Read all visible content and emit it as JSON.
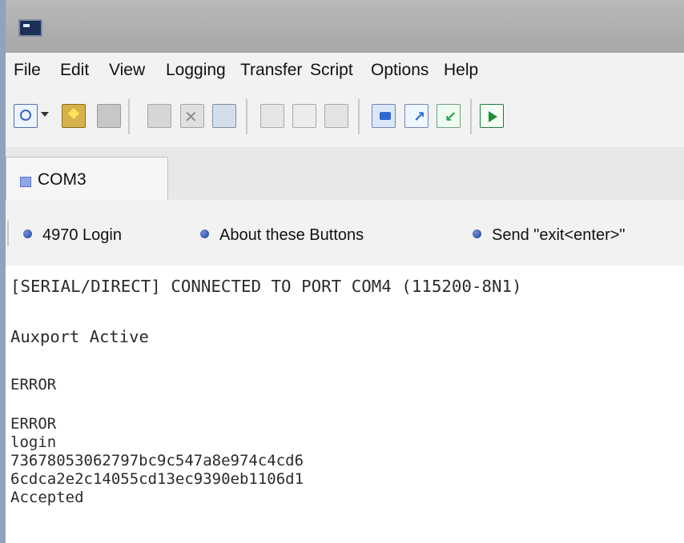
{
  "menu": [
    "File",
    "Edit",
    "View",
    "Logging",
    "Transfer",
    "Script",
    "Options",
    "Help"
  ],
  "toolbar": {
    "icons": [
      "connect-icon",
      "dropdown-arrow-icon",
      "quick-connect-icon",
      "connect-in-tab-icon",
      "reconnect-icon",
      "disconnect-icon",
      "session-options-icon",
      "copy-icon",
      "paste-icon",
      "print-icon",
      "transfer-icon",
      "send-file-icon",
      "receive-file-icon",
      "run-script-icon"
    ]
  },
  "tab": {
    "label": "COM3"
  },
  "button_bar": {
    "buttons": [
      "4970 Login",
      "About these Buttons",
      "Send \"exit<enter>\""
    ]
  },
  "terminal": {
    "lines": [
      "[SERIAL/DIRECT] CONNECTED TO PORT COM4 (115200-8N1)",
      "Auxport Active",
      "ERROR",
      "ERROR",
      "login",
      "73678053062797bc9c547a8e974c4cd6",
      "6cdca2e2c14055cd13ec9390eb1106d1",
      "Accepted"
    ]
  }
}
